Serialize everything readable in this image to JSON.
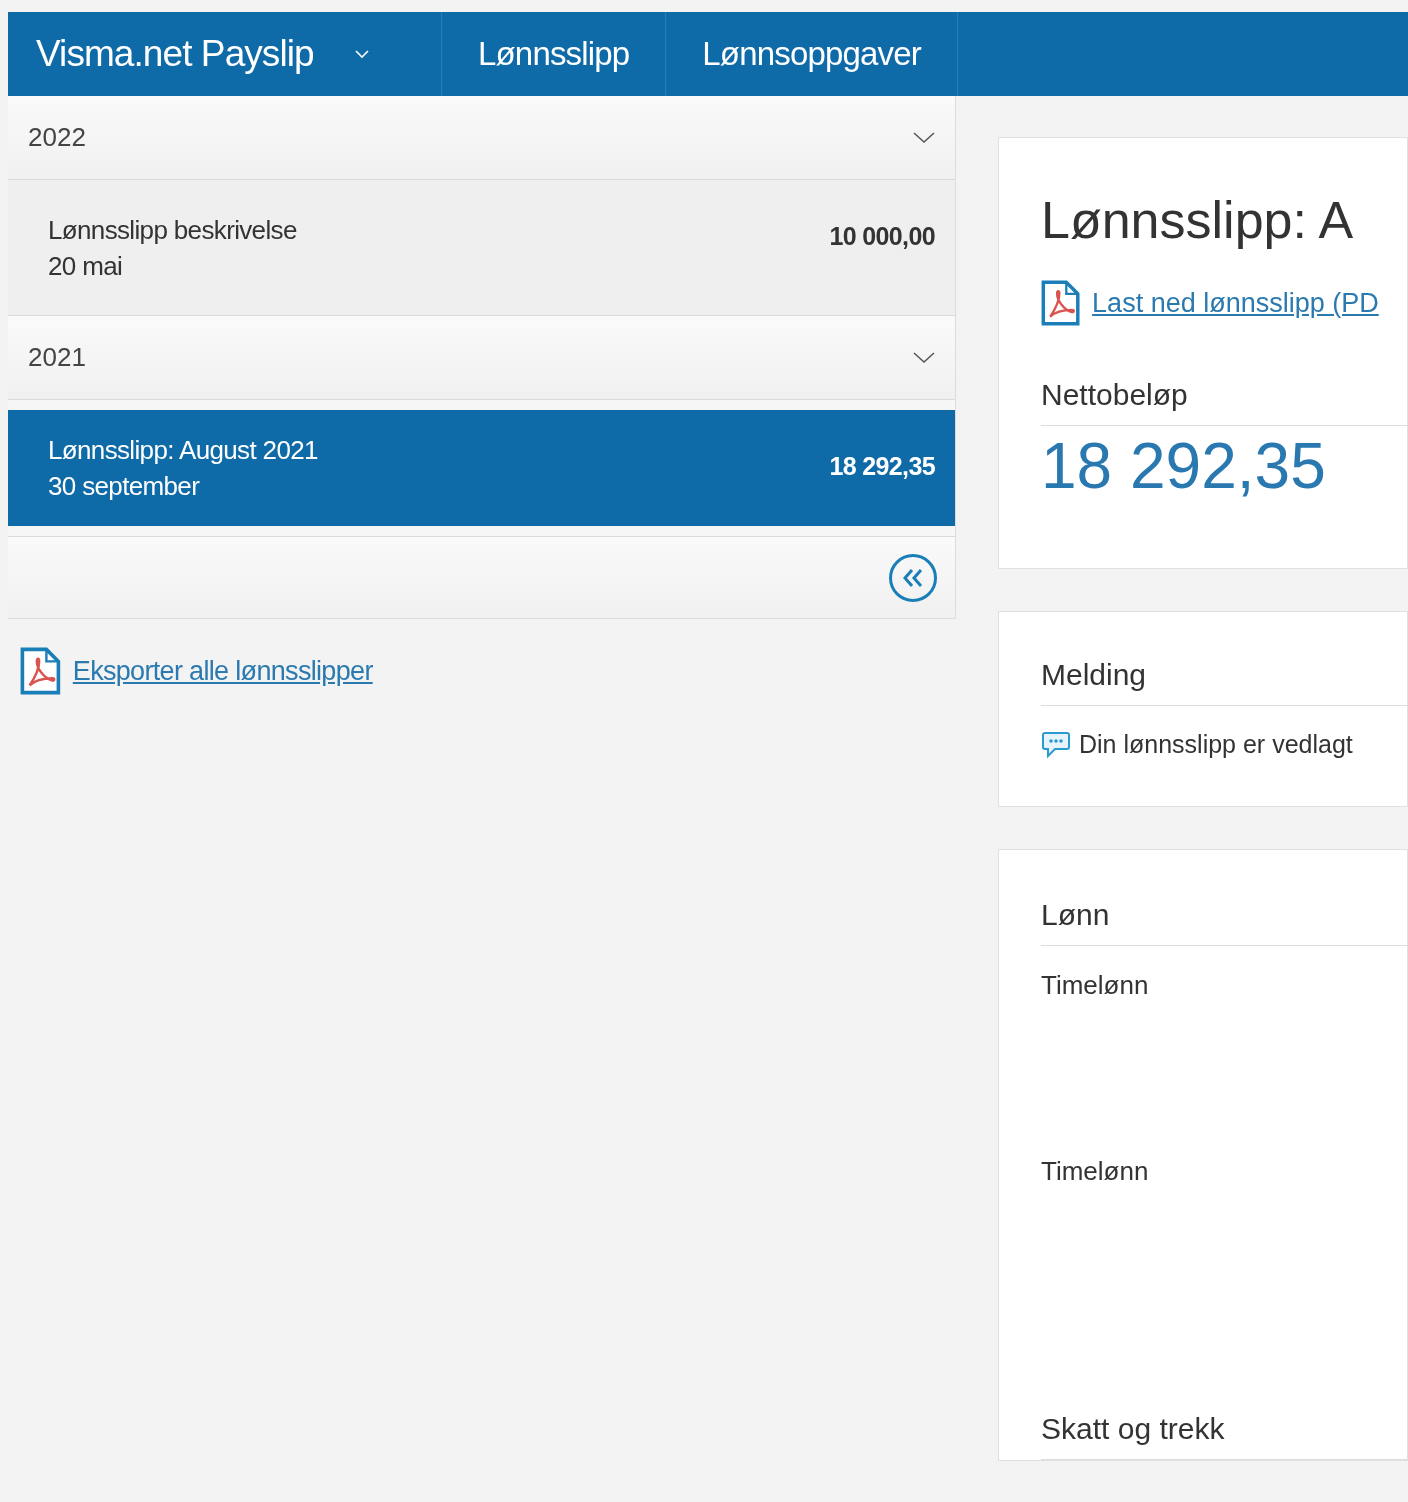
{
  "nav": {
    "app_title": "Visma.net Payslip",
    "menu": [
      "Lønnsslipp",
      "Lønnsoppgaver"
    ]
  },
  "years": [
    {
      "year": "2022",
      "expanded": true,
      "payslips": [
        {
          "title": "Lønnsslipp beskrivelse",
          "date": "20 mai",
          "amount": "10 000,00",
          "selected": false
        }
      ]
    },
    {
      "year": "2021",
      "expanded": true,
      "payslips": [
        {
          "title": "Lønnsslipp: August 2021",
          "date": "30 september",
          "amount": "18 292,35",
          "selected": true
        }
      ]
    }
  ],
  "export_link": "Eksporter alle lønnsslipper",
  "detail": {
    "title": "Lønnsslipp: A",
    "download_link": "Last ned lønnsslipp (PD",
    "net_label": "Nettobeløp",
    "net_amount": "18 292,35",
    "message_heading": "Melding",
    "message_text": "Din lønnsslipp er vedlagt",
    "salary_heading": "Lønn",
    "salary_rows": [
      "Timelønn",
      "Timelønn"
    ],
    "tax_heading": "Skatt og trekk"
  }
}
